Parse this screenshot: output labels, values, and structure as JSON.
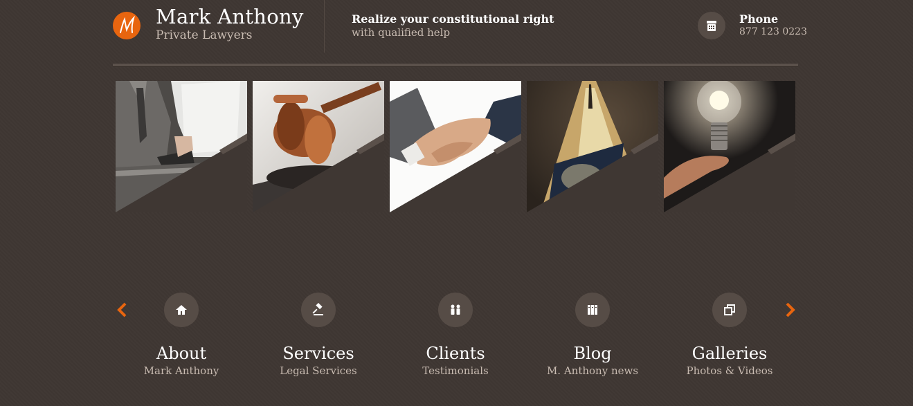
{
  "brand": {
    "logo_letter": "M",
    "title": "Mark Anthony",
    "subtitle": "Private Lawyers",
    "accent_color": "#e8650f"
  },
  "tagline": {
    "line1": "Realize your constitutional right",
    "line2": "with qualified help"
  },
  "contact": {
    "icon": "phone-icon",
    "label": "Phone",
    "number": "877 123 0223"
  },
  "gallery": [
    {
      "name": "businessman-with-documents-photo"
    },
    {
      "name": "judge-gavel-photo"
    },
    {
      "name": "handshake-photo"
    },
    {
      "name": "fountain-pen-nib-photo"
    },
    {
      "name": "light-bulb-in-hand-photo"
    }
  ],
  "carousel": {
    "prev_icon": "chevron-left-icon",
    "next_icon": "chevron-right-icon"
  },
  "nav": [
    {
      "icon": "home-icon",
      "title": "About",
      "subtitle": "Mark Anthony"
    },
    {
      "icon": "gavel-icon",
      "title": "Services",
      "subtitle": "Legal Services"
    },
    {
      "icon": "people-icon",
      "title": "Clients",
      "subtitle": "Testimonials"
    },
    {
      "icon": "books-icon",
      "title": "Blog",
      "subtitle": "M. Anthony news"
    },
    {
      "icon": "gallery-icon",
      "title": "Galleries",
      "subtitle": "Photos & Videos"
    }
  ]
}
